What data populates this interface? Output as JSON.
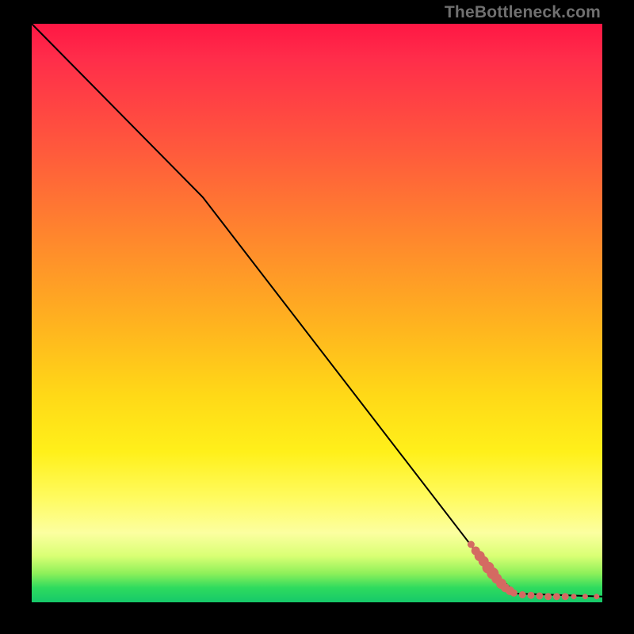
{
  "attribution": "TheBottleneck.com",
  "colors": {
    "dot": "#d46a62",
    "curve": "#000000",
    "gradient_top": "#ff1744",
    "gradient_bottom": "#16c96a"
  },
  "chart_data": {
    "type": "line",
    "title": "",
    "xlabel": "",
    "ylabel": "",
    "xlim": [
      0,
      100
    ],
    "ylim": [
      0,
      100
    ],
    "grid": false,
    "legend": false,
    "curve": [
      {
        "x": 0,
        "y": 100
      },
      {
        "x": 24,
        "y": 76
      },
      {
        "x": 30,
        "y": 70
      },
      {
        "x": 80,
        "y": 6
      },
      {
        "x": 85,
        "y": 1.5
      },
      {
        "x": 100,
        "y": 1.0
      }
    ],
    "scatter": [
      {
        "x": 77.0,
        "y": 10.0,
        "r": 4
      },
      {
        "x": 77.8,
        "y": 8.9,
        "r": 5
      },
      {
        "x": 78.5,
        "y": 8.0,
        "r": 6
      },
      {
        "x": 79.2,
        "y": 7.1,
        "r": 6
      },
      {
        "x": 80.0,
        "y": 6.0,
        "r": 7
      },
      {
        "x": 80.8,
        "y": 5.0,
        "r": 7
      },
      {
        "x": 81.5,
        "y": 4.1,
        "r": 6
      },
      {
        "x": 82.3,
        "y": 3.2,
        "r": 6
      },
      {
        "x": 83.0,
        "y": 2.5,
        "r": 5
      },
      {
        "x": 83.8,
        "y": 2.0,
        "r": 5
      },
      {
        "x": 84.5,
        "y": 1.6,
        "r": 4
      },
      {
        "x": 86.0,
        "y": 1.3,
        "r": 4
      },
      {
        "x": 87.5,
        "y": 1.2,
        "r": 4
      },
      {
        "x": 89.0,
        "y": 1.1,
        "r": 4
      },
      {
        "x": 90.5,
        "y": 1.0,
        "r": 4
      },
      {
        "x": 92.0,
        "y": 1.0,
        "r": 4
      },
      {
        "x": 93.5,
        "y": 1.0,
        "r": 4
      },
      {
        "x": 95.0,
        "y": 1.0,
        "r": 3
      },
      {
        "x": 97.0,
        "y": 1.0,
        "r": 3
      },
      {
        "x": 99.0,
        "y": 1.0,
        "r": 3
      }
    ]
  }
}
